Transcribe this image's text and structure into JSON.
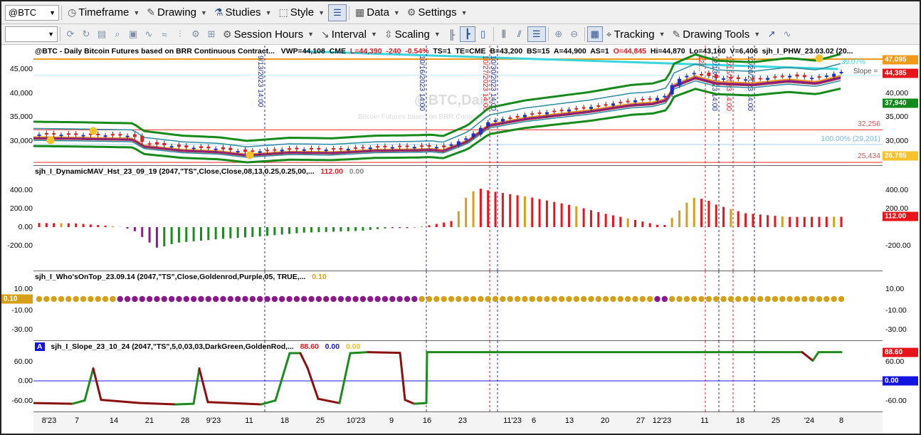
{
  "toolbar1": {
    "symbol": "@BTC",
    "items": [
      "Timeframe",
      "Drawing",
      "Studies",
      "Style",
      "Data",
      "Settings"
    ]
  },
  "toolbar2": {
    "items": [
      "Session Hours",
      "Interval",
      "Scaling",
      "Tracking",
      "Drawing Tools"
    ]
  },
  "price_pane": {
    "header": {
      "title": "@BTC - Daily  Bitcoin Futures based on BRR Continuous Contract...",
      "vwap": "VWP=44,108",
      "exch": "CME",
      "last": "L=44,390",
      "chg": "-240",
      "pct": "-0.54%",
      "ts": "TS=1",
      "te": "TE=CME",
      "bid": "B=43,200",
      "bs": "BS=15",
      "ask": "A=44,900",
      "as": "AS=1",
      "open": "O=44,845",
      "high": "Hi=44,870",
      "low": "Lo=43,160",
      "vol": "V=6,406",
      "study": "sjh_I_PHW_23.03.02 (20..."
    },
    "watermark": "@BTC,Daily",
    "watermark_sub": "Bitcoin Futures based on BRR Continuous",
    "axis_ticks": [
      "45,000",
      "40,000",
      "35,000",
      "30,000"
    ],
    "right_ticks": [
      "45,000",
      "40,000",
      "35,000",
      "30,000"
    ],
    "tags": [
      {
        "text": "47,095",
        "color": "#f29a18"
      },
      {
        "text": "44,385",
        "color": "#e8141c"
      },
      {
        "text": "37,940",
        "color": "#108a1a"
      },
      {
        "text": "26,785",
        "color": "#f7c12a"
      }
    ],
    "level_labels": [
      "32,256",
      "100.00% (29,201)",
      "25,434"
    ],
    "annot": [
      "39.07%",
      "Slope ="
    ],
    "vline_labels": [
      "9/13/2023 14:00",
      "10/16/2023 14:00",
      "10/27/2023 14:00",
      "10/30/2023 14:00",
      "12/...",
      "12/13/2023 14:00",
      "12/15/2023 14:00",
      "12/20/2023 14:00"
    ]
  },
  "dmav_pane": {
    "header": {
      "name": "sjh_I_DynamicMAV_Hst_23_09_19 (2047,\"TS\",Close,Close,08,13,0.25,0.25,00,...",
      "v1": "112.00",
      "v2": "0.00"
    },
    "axis_ticks": [
      "400.00",
      "200.00",
      "0.00",
      "-200.00"
    ],
    "right_ticks": [
      "400.00",
      "200.00",
      "-200.00"
    ],
    "tag": "112.00"
  },
  "who_pane": {
    "header": {
      "name": "sjh_I_Who'sOnTop_23.09.14 (2047,\"TS\",Close,Goldenrod,Purple,05,  TRUE,...",
      "v1": "0.10"
    },
    "axis_ticks": [
      "10.00",
      "-10.00",
      "-30.00"
    ],
    "right_ticks": [
      "10.00",
      "-10.00",
      "-30.00"
    ],
    "tag": "0.10"
  },
  "slope_pane": {
    "badge": "A",
    "header": {
      "name": "sjh_I_Slope_23_10_24 (2047,\"TS\",5,0,03,03,DarkGreen,GoldenRod,...",
      "v1": "88.60",
      "v2": "0.00",
      "v3": "0.00"
    },
    "axis_ticks": [
      "60.00",
      "0.00",
      "-60.00"
    ],
    "right_ticks": [
      "60.00",
      "-60.00"
    ],
    "tags": [
      {
        "text": "88.60",
        "color": "#e8141c"
      },
      {
        "text": "0.00",
        "color": "#1414e0"
      }
    ]
  },
  "x_axis": {
    "labels": [
      "8'23",
      "7",
      "14",
      "21",
      "28",
      "9'23",
      "11",
      "18",
      "25",
      "10'23",
      "9",
      "16",
      "23",
      "11'23",
      "6",
      "13",
      "20",
      "27",
      "12'23",
      "11",
      "18",
      "25",
      "'24",
      "8"
    ]
  },
  "chart_data": [
    {
      "type": "line",
      "title": "@BTC - Daily Bitcoin Futures based on BRR Continuous Contract",
      "y_ticks": [
        30000,
        35000,
        40000,
        45000
      ],
      "last": 44390,
      "open": 44845,
      "high": 44870,
      "low": 43160,
      "vwap": 44108,
      "levels": [
        32256,
        29201,
        25434,
        47095,
        44385,
        37940,
        26785
      ],
      "series": [
        {
          "values": [
            31300,
            31200,
            31000,
            29500,
            28600,
            28300,
            27600,
            28200,
            28100,
            28600,
            28700,
            28800,
            28500,
            30600,
            34000,
            35400,
            36300,
            37000,
            37700,
            38400,
            38700,
            39500,
            42500,
            44300,
            43100,
            42800,
            43600,
            43100,
            44400
          ]
        }
      ]
    },
    {
      "type": "bar",
      "title": "sjh_I_DynamicMAV_Hst_23_09_19",
      "y_ticks": [
        -200,
        0,
        200,
        400
      ],
      "last": 112
    },
    {
      "type": "scatter",
      "title": "sjh_I_Who'sOnTop_23.09.14",
      "y_ticks": [
        -30,
        -10,
        10
      ],
      "last": 0.1
    },
    {
      "type": "line",
      "title": "sjh_I_Slope_23_10_24",
      "y_ticks": [
        -60,
        0,
        60
      ],
      "last": 88.6
    }
  ]
}
